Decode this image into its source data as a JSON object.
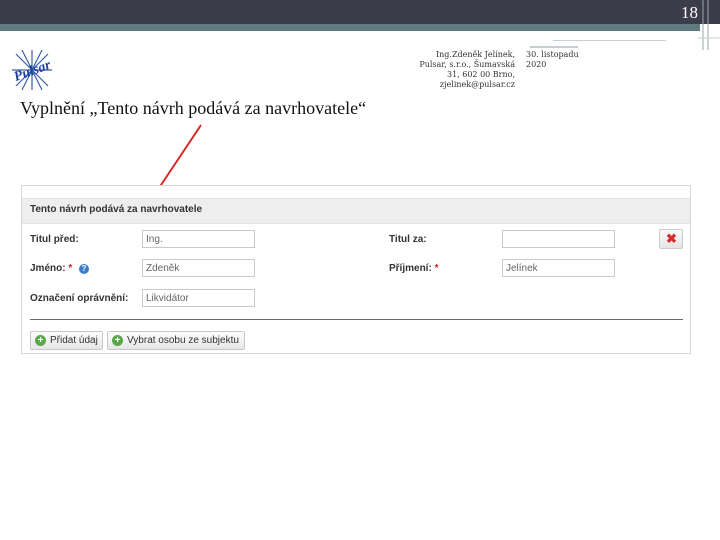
{
  "slide": {
    "page_number": "18",
    "logo_text": "Pulsar",
    "author_lines": [
      "Ing.Zdeněk Jelínek,",
      "Pulsar, s.r.o., Šumavská",
      "31, 602 00 Brno,",
      "zjelinek@pulsar.cz"
    ],
    "date_lines": [
      "30. listopadu",
      "2020"
    ],
    "title": "Vyplnění „Tento návrh podává za navrhovatele“"
  },
  "form": {
    "section_title": "Tento návrh podává za navrhovatele",
    "title_before": {
      "label": "Titul před:",
      "value": "Ing."
    },
    "title_after": {
      "label": "Titul za:",
      "value": ""
    },
    "first_name": {
      "label": "Jméno:",
      "required_mark": "*",
      "value": "Zdeněk"
    },
    "last_name": {
      "label": "Příjmení:",
      "required_mark": "*",
      "value": "Jelínek"
    },
    "authorization": {
      "label": "Označení oprávnění:",
      "value": "Likvidátor"
    },
    "delete_symbol": "✖",
    "help_symbol": "?",
    "add_symbol": "+",
    "buttons": {
      "add_item": "Přidat údaj",
      "select_person": "Vybrat osobu ze subjektu"
    }
  },
  "colors": {
    "top_bar": "#3c3c4b",
    "accent_bar": "#5f7b80",
    "arrow": "#d42a2a",
    "delete": "#d23030",
    "add": "#5aa84a",
    "help": "#3b7dc9"
  },
  "icons": [
    "pulsar-logo",
    "delete-icon",
    "help-icon",
    "plus-icon",
    "plus-icon"
  ]
}
